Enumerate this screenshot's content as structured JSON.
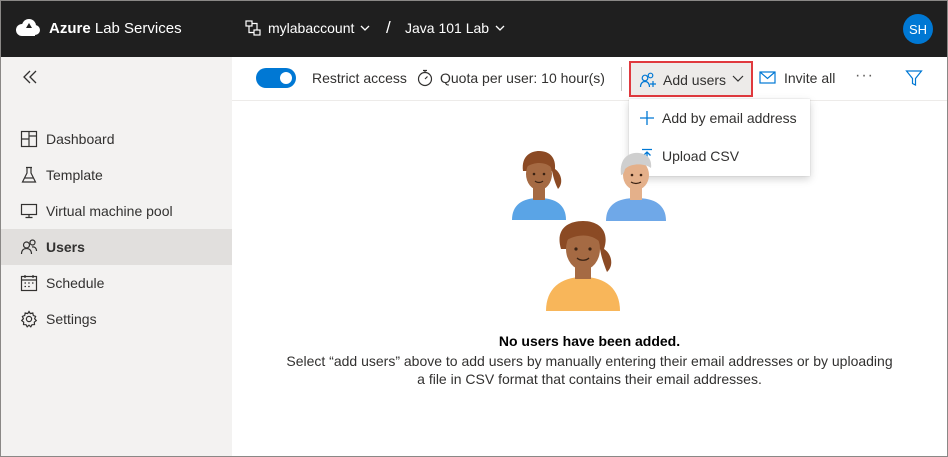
{
  "header": {
    "brand_bold": "Azure",
    "brand_rest": " Lab Services",
    "account": "mylabaccount",
    "separator": "/",
    "lab": "Java 101 Lab",
    "user_initials": "SH"
  },
  "sidebar": {
    "items": [
      {
        "label": "Dashboard",
        "icon": "dashboard-icon"
      },
      {
        "label": "Template",
        "icon": "flask-icon"
      },
      {
        "label": "Virtual machine pool",
        "icon": "monitor-icon"
      },
      {
        "label": "Users",
        "icon": "users-icon",
        "active": true
      },
      {
        "label": "Schedule",
        "icon": "calendar-icon"
      },
      {
        "label": "Settings",
        "icon": "gear-icon"
      }
    ]
  },
  "toolbar": {
    "restrict_access": "Restrict access",
    "restrict_access_on": true,
    "quota": "Quota per user: 10 hour(s)",
    "add_users": "Add users",
    "invite_all": "Invite all",
    "more": "···"
  },
  "add_users_menu": {
    "items": [
      {
        "label": "Add by email address",
        "icon": "plus-icon"
      },
      {
        "label": "Upload CSV",
        "icon": "upload-icon"
      }
    ]
  },
  "empty_state": {
    "title": "No users have been added.",
    "description": "Select “add users” above to add users by manually entering their email addresses or by uploading a file in CSV format that contains their email addresses."
  },
  "colors": {
    "topbar": "#1f1f1f",
    "accent": "#0078d4",
    "highlight_border": "#e0393e",
    "sidebar_bg": "#f3f2f1"
  }
}
